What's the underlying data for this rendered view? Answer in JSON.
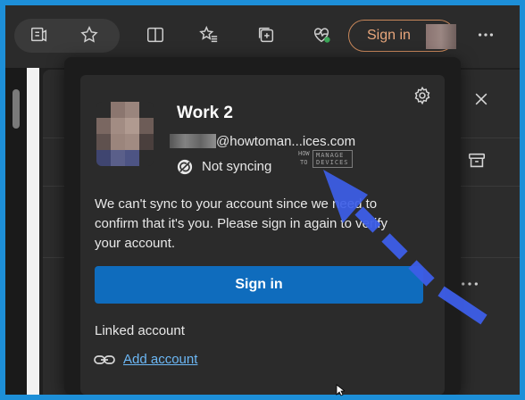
{
  "toolbar": {
    "signin_label": "Sign in",
    "icons": [
      "immersive-reader-icon",
      "add-favorite-icon",
      "split-screen-icon",
      "favorites-icon",
      "collections-icon",
      "browser-essentials-icon",
      "more-icon"
    ]
  },
  "profile": {
    "name": "Work 2",
    "email": "@howtoman...ices.com",
    "sync_status": "Not syncing"
  },
  "message": "We can't sync to your account since we need to confirm that it's you. Please sign in again to verify your account.",
  "signin_button": "Sign in",
  "linked_account_label": "Linked account",
  "add_account_label": "Add account",
  "watermark": {
    "small_top": "HOW",
    "small_bottom": "TO",
    "box_top": "MANAGE",
    "box_bottom": "DEVICES"
  },
  "colors": {
    "accent": "#0f6cbd",
    "link": "#6cb8f6",
    "frame": "#1d8fd8",
    "annotation_arrow": "#3d5ee8",
    "signin_pill": "#e9a77c"
  }
}
